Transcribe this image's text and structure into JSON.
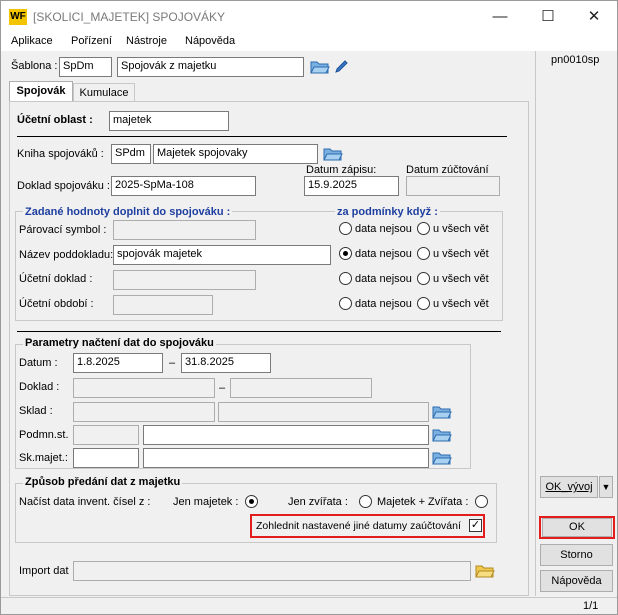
{
  "window": {
    "title": "[SKOLICI_MAJETEK] SPOJOVÁKY",
    "logo": "WF",
    "min_glyph": "—",
    "max_glyph": "☐",
    "close_glyph": "✕"
  },
  "menu": [
    "Aplikace",
    "Pořízení",
    "Nástroje",
    "Nápověda"
  ],
  "header": {
    "sablona_label": "Šablona :",
    "sablona_code": "SpDm",
    "sablona_name": "Spojovák z majetku",
    "form_code": "pn0010sp"
  },
  "tabs": [
    {
      "label": "Spojovák"
    },
    {
      "label": "Kumulace"
    }
  ],
  "ucetni_oblast": {
    "label": "Účetní oblast :",
    "value": "majetek"
  },
  "kniha": {
    "label": "Kniha spojováků :",
    "code": "SPdm",
    "name": "Majetek spojovaky"
  },
  "doklad": {
    "label": "Doklad spojováku :",
    "value": "2025-SpMa-108",
    "datum_zapisu_label": "Datum zápisu:",
    "datum_zapisu": "15.9.2025",
    "datum_zuct_label": "Datum zúčtování",
    "datum_zuct": ""
  },
  "zadane": {
    "title": "Zadané hodnoty doplnit do spojováku :",
    "cond_title": "za podmínky když :",
    "opt_a": "data nejsou",
    "opt_b": "u všech vět",
    "rows": [
      {
        "label": "Párovací symbol :",
        "value": ""
      },
      {
        "label": "Název poddokladu:",
        "value": "spojovák majetek"
      },
      {
        "label": "Účetní doklad :",
        "value": ""
      },
      {
        "label": "Účetní období :",
        "value": ""
      }
    ]
  },
  "parametry": {
    "title": "Parametry načtení dat do spojováku",
    "datum_label": "Datum :",
    "datum_from": "1.8.2025",
    "dash": "–",
    "datum_to": "31.8.2025",
    "doklad_label": "Doklad :",
    "sklad_label": "Sklad :",
    "podmn_label": "Podmn.st.",
    "skmajet_label": "Sk.majet.:"
  },
  "zpusob": {
    "title": "Způsob předání dat z majetku",
    "nacist_label": "Načíst data invent. čísel z :",
    "jen_majetek": "Jen majetek :",
    "jen_zvirata": "Jen zvířata :",
    "majetek_zvirata": "Majetek + Zvířata :",
    "zohlednit": "Zohlednit nastavené jiné datumy zaúčtování",
    "zohlednit_checked": "✓"
  },
  "import": {
    "label": "Import dat",
    "value": ""
  },
  "buttons": {
    "ok_vyvoj": "OK_vývoj",
    "arrow": "▼",
    "ok": "OK",
    "storno": "Storno",
    "napoveda": "Nápověda"
  },
  "status": {
    "page": "1/1"
  },
  "colors": {
    "highlight": "#e31c1c",
    "group_title": "#1e3fa0"
  }
}
